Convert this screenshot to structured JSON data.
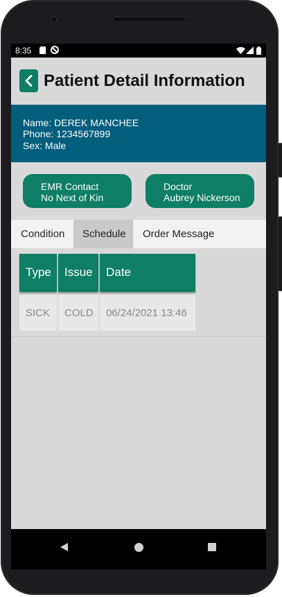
{
  "status_bar": {
    "time": "8:35"
  },
  "header": {
    "title": "Patient Detail Information"
  },
  "patient": {
    "name": "Name: DEREK MANCHEE",
    "phone": "Phone: 1234567899",
    "sex": "Sex: Male"
  },
  "buttons": {
    "emr": {
      "line1": "EMR Contact",
      "line2": "No Next of Kin"
    },
    "doctor": {
      "line1": "Doctor",
      "line2": "Aubrey Nickerson"
    }
  },
  "tabs": [
    {
      "label": "Condition",
      "active": false
    },
    {
      "label": "Schedule",
      "active": true
    },
    {
      "label": "Order Message",
      "active": false
    }
  ],
  "table": {
    "headers": [
      "Type",
      "Issue",
      "Date"
    ],
    "rows": [
      [
        "SICK",
        "COLD",
        "06/24/2021 13:46"
      ]
    ]
  },
  "colors": {
    "accent_green": "#0e7f64",
    "info_band_blue": "#015e7c",
    "screen_background": "#d9d9d9"
  },
  "icons": [
    "back-chevron-icon",
    "sim-card-icon",
    "do-not-disturb-icon",
    "wifi-icon",
    "signal-icon",
    "battery-icon",
    "nav-back-icon",
    "nav-home-icon",
    "nav-recents-icon"
  ]
}
